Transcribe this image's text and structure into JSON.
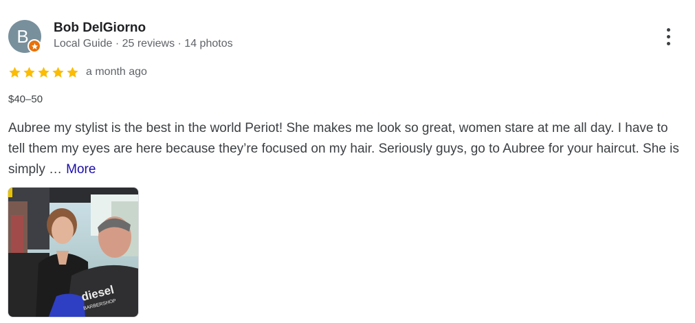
{
  "review": {
    "author": {
      "initial": "B",
      "name": "Bob DelGiorno",
      "meta": "Local Guide · 25 reviews · 14 photos",
      "avatar_color": "#78909c",
      "badge_icon": "local-guide-star-icon",
      "badge_color": "#e8710a"
    },
    "rating": {
      "stars": 5,
      "max": 5,
      "star_color": "#fbbc04"
    },
    "date": "a month ago",
    "price": "$40–50",
    "text": "Aubree my stylist is the best in the world Periot! She makes me look so great, women stare at me all day. I have to tell them my eyes are here because they’re focused on my hair. Seriously guys, go to Aubree for your haircut. She is simply …",
    "more_label": "More",
    "more_color": "#1a0dab",
    "photo": {
      "cape_text": "diesel",
      "cape_subtext": "BARBERSHOP"
    },
    "menu_icon": "more-vert-icon"
  }
}
